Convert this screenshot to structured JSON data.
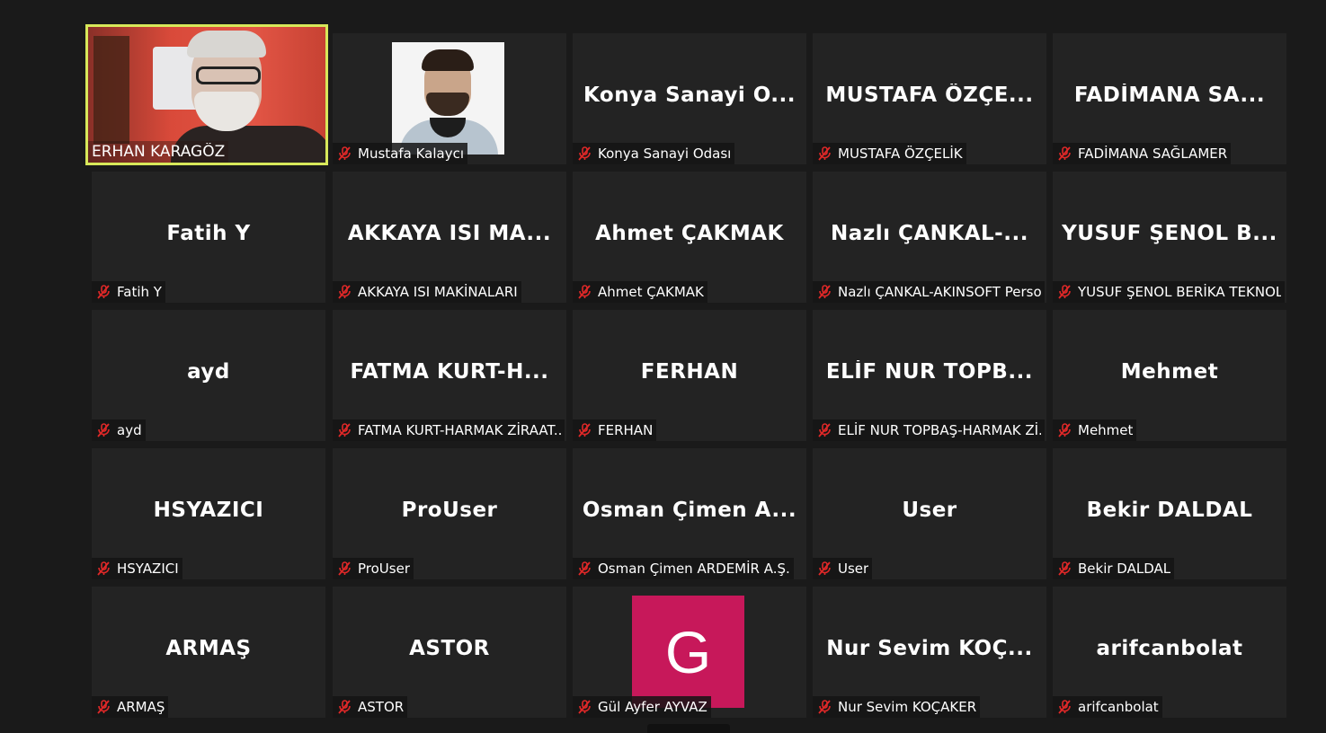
{
  "colors": {
    "active_border": "#d7e85a",
    "avatar_bg": "#c7185a",
    "tile_bg": "#232323",
    "mic_muted": "#e02828"
  },
  "participants": [
    {
      "display": "",
      "label": "ERHAN KARAGÖZ",
      "kind": "video",
      "active": true,
      "muted": false
    },
    {
      "display": "",
      "label": "Mustafa Kalaycı",
      "kind": "photo",
      "muted": true
    },
    {
      "display": "Konya Sanayi O...",
      "label": "Konya Sanayi Odası",
      "kind": "name",
      "muted": true
    },
    {
      "display": "MUSTAFA ÖZÇE...",
      "label": "MUSTAFA ÖZÇELİK",
      "kind": "name",
      "muted": true
    },
    {
      "display": "FADİMANA SA...",
      "label": "FADİMANA SAĞLAMER",
      "kind": "name",
      "muted": true
    },
    {
      "display": "Fatih Y",
      "label": "Fatih Y",
      "kind": "name",
      "muted": true
    },
    {
      "display": "AKKAYA ISI MA...",
      "label": "AKKAYA ISI MAKİNALARI",
      "kind": "name",
      "muted": true
    },
    {
      "display": "Ahmet ÇAKMAK",
      "label": "Ahmet ÇAKMAK",
      "kind": "name",
      "muted": true
    },
    {
      "display": "Nazlı ÇANKAL-...",
      "label": "Nazlı ÇANKAL-AKINSOFT Perso...",
      "kind": "name",
      "muted": true
    },
    {
      "display": "YUSUF ŞENOL B...",
      "label": "YUSUF ŞENOL BERİKA TEKNOL...",
      "kind": "name",
      "muted": true
    },
    {
      "display": "ayd",
      "label": "ayd",
      "kind": "name",
      "muted": true
    },
    {
      "display": "FATMA KURT-H...",
      "label": "FATMA KURT-HARMAK ZİRAAT...",
      "kind": "name",
      "muted": true
    },
    {
      "display": "FERHAN",
      "label": "FERHAN",
      "kind": "name",
      "muted": true
    },
    {
      "display": "ELİF NUR TOPB...",
      "label": "ELİF NUR TOPBAŞ-HARMAK Zİ...",
      "kind": "name",
      "muted": true
    },
    {
      "display": "Mehmet",
      "label": "Mehmet",
      "kind": "name",
      "muted": true
    },
    {
      "display": "HSYAZICI",
      "label": "HSYAZICI",
      "kind": "name",
      "muted": true
    },
    {
      "display": "ProUser",
      "label": "ProUser",
      "kind": "name",
      "muted": true
    },
    {
      "display": "Osman Çimen A...",
      "label": "Osman Çimen ARDEMİR A.Ş.",
      "kind": "name",
      "muted": true
    },
    {
      "display": "User",
      "label": "User",
      "kind": "name",
      "muted": true
    },
    {
      "display": "Bekir DALDAL",
      "label": "Bekir DALDAL",
      "kind": "name",
      "muted": true
    },
    {
      "display": "ARMAŞ",
      "label": "ARMAŞ",
      "kind": "name",
      "muted": true
    },
    {
      "display": "ASTOR",
      "label": "ASTOR",
      "kind": "name",
      "muted": true
    },
    {
      "display": "G",
      "label": "Gül Ayfer AYVAZ",
      "kind": "avatar",
      "muted": true
    },
    {
      "display": "Nur Sevim KOÇ...",
      "label": "Nur Sevim KOÇAKER",
      "kind": "name",
      "muted": true
    },
    {
      "display": "arifcanbolat",
      "label": "arifcanbolat",
      "kind": "name",
      "muted": true
    }
  ],
  "icons": {
    "mic": "mic-muted-icon"
  }
}
